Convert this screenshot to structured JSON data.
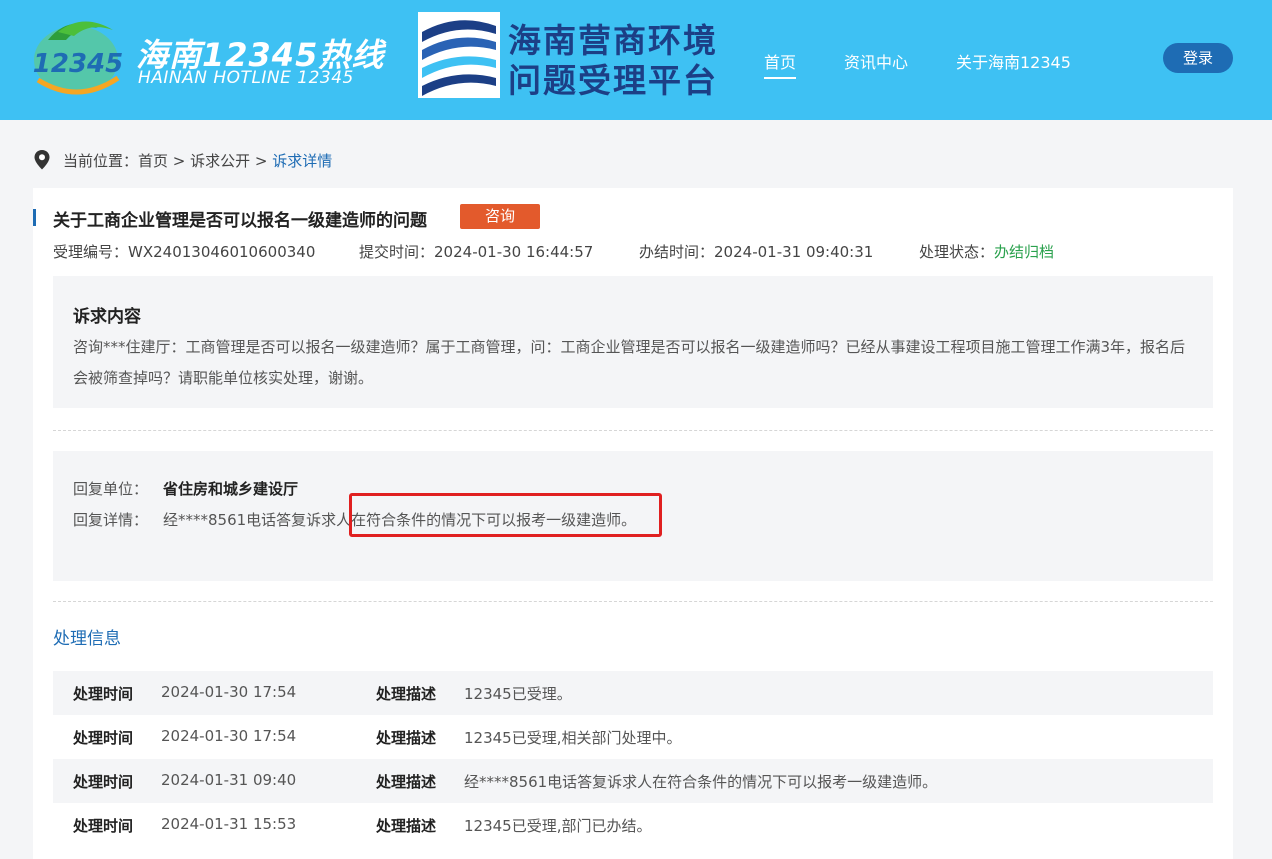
{
  "header": {
    "brand_cn": "海南12345热线",
    "brand_en": "HAINAN HOTLINE 12345",
    "logo_text": "12345",
    "platform_line1": "海南营商环境",
    "platform_line2": "问题受理平台",
    "nav": [
      {
        "label": "首页",
        "active": true
      },
      {
        "label": "资讯中心"
      },
      {
        "label": "关于海南12345"
      }
    ],
    "login_label": "登录"
  },
  "breadcrumb": {
    "prefix": "当前位置：",
    "home": "首页",
    "sep1": " > ",
    "section": "诉求公开",
    "sep2": " > ",
    "current": "诉求详情"
  },
  "detail": {
    "title": "关于工商企业管理是否可以报名一级建造师的问题",
    "tag": "咨询",
    "meta": {
      "id_label": "受理编号：",
      "id_value": "WX24013046010600340",
      "submit_label": "提交时间：",
      "submit_value": "2024-01-30 16:44:57",
      "done_label": "办结时间：",
      "done_value": "2024-01-31 09:40:31",
      "status_label": "处理状态：",
      "status_value": "办结归档"
    },
    "content_title": "诉求内容",
    "content_text": "咨询***住建厅：工商管理是否可以报名一级建造师？属于工商管理，问：工商企业管理是否可以报名一级建造师吗？已经从事建设工程项目施工管理工作满3年，报名后会被筛查掉吗？请职能单位核实处理，谢谢。",
    "reply": {
      "unit_label": "回复单位：",
      "unit_value": "省住房和城乡建设厅",
      "detail_label": "回复详情：",
      "detail_value": "经****8561电话答复诉求人在符合条件的情况下可以报考一级建造师。"
    },
    "process_title": "处理信息",
    "process": [
      {
        "time_label": "处理时间",
        "time": "2024-01-30 17:54",
        "desc_label": "处理描述",
        "desc": "12345已受理。"
      },
      {
        "time_label": "处理时间",
        "time": "2024-01-30 17:54",
        "desc_label": "处理描述",
        "desc": "12345已受理,相关部门处理中。"
      },
      {
        "time_label": "处理时间",
        "time": "2024-01-31 09:40",
        "desc_label": "处理描述",
        "desc": "经****8561电话答复诉求人在符合条件的情况下可以报考一级建造师。"
      },
      {
        "time_label": "处理时间",
        "time": "2024-01-31 15:53",
        "desc_label": "处理描述",
        "desc": "12345已受理,部门已办结。"
      }
    ]
  },
  "colors": {
    "header_bg": "#3ec1f3",
    "brand_blue": "#1e6cb4",
    "tag_orange": "#e35a2c",
    "status_green": "#2aa14d",
    "highlight_red": "#e02020"
  }
}
